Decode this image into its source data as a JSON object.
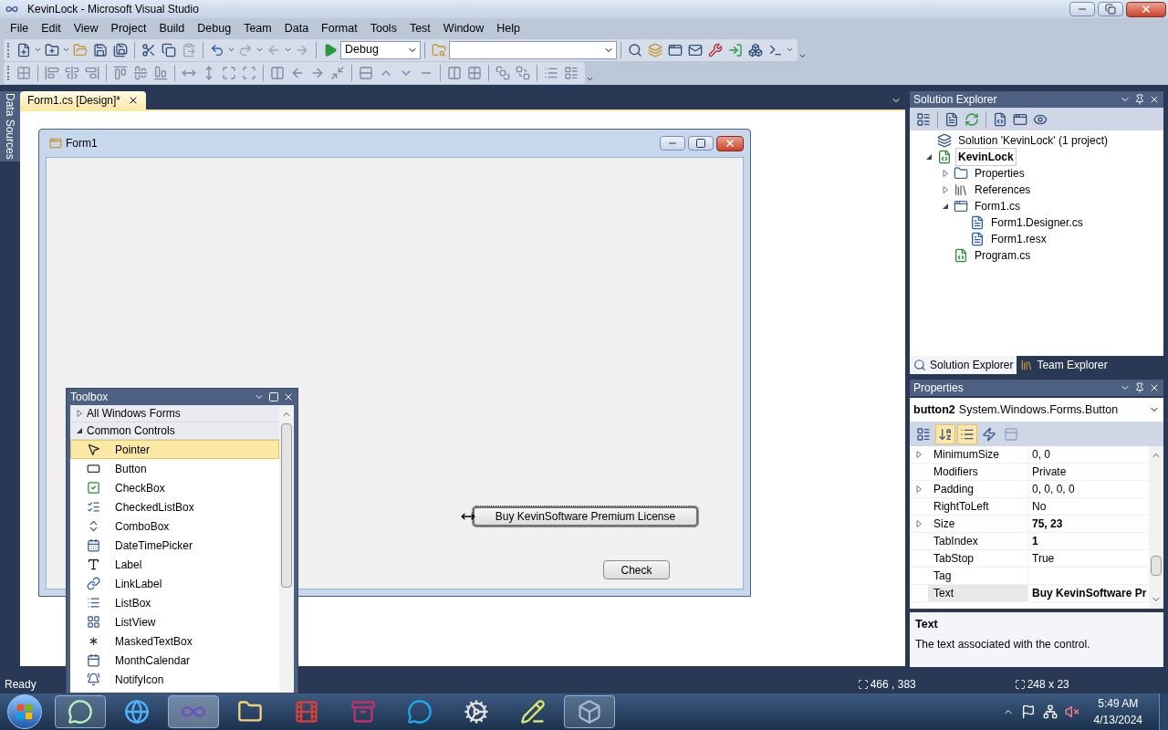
{
  "window": {
    "title": "KevinLock - Microsoft Visual Studio"
  },
  "menu": [
    "File",
    "Edit",
    "View",
    "Project",
    "Build",
    "Debug",
    "Team",
    "Data",
    "Format",
    "Tools",
    "Test",
    "Window",
    "Help"
  ],
  "toolbar": {
    "configuration": "Debug"
  },
  "side_tabs": [
    "Data Sources"
  ],
  "document_tabs": [
    {
      "label": "Form1.cs [Design]*",
      "selected": true
    }
  ],
  "form": {
    "title": "Form1",
    "controls": [
      {
        "text": "Buy KevinSoftware Premium License",
        "selected": true,
        "kind": "wide"
      },
      {
        "text": "Check",
        "selected": false,
        "kind": "small"
      }
    ]
  },
  "toolbox": {
    "title": "Toolbox",
    "groups": [
      {
        "label": "All Windows Forms",
        "expanded": false
      },
      {
        "label": "Common Controls",
        "expanded": true,
        "items": [
          {
            "label": "Pointer",
            "kind": "pointer",
            "selected": true
          },
          {
            "label": "Button",
            "kind": "button",
            "selected": false
          },
          {
            "label": "CheckBox",
            "kind": "checkbox",
            "selected": false
          },
          {
            "label": "CheckedListBox",
            "kind": "checkedlistbox",
            "selected": false
          },
          {
            "label": "ComboBox",
            "kind": "combobox",
            "selected": false
          },
          {
            "label": "DateTimePicker",
            "kind": "datetimepicker",
            "selected": false
          },
          {
            "label": "Label",
            "kind": "label",
            "selected": false
          },
          {
            "label": "LinkLabel",
            "kind": "linklabel",
            "selected": false
          },
          {
            "label": "ListBox",
            "kind": "listbox",
            "selected": false
          },
          {
            "label": "ListView",
            "kind": "listview",
            "selected": false
          },
          {
            "label": "MaskedTextBox",
            "kind": "maskedtextbox",
            "selected": false
          },
          {
            "label": "MonthCalendar",
            "kind": "monthcalendar",
            "selected": false
          },
          {
            "label": "NotifyIcon",
            "kind": "notifyicon",
            "selected": false
          }
        ]
      }
    ]
  },
  "solution_explorer": {
    "title": "Solution Explorer",
    "tree": [
      {
        "label": "Solution 'KevinLock' (1 project)",
        "kind": "solution",
        "selected": false,
        "children": [
          {
            "label": "KevinLock",
            "kind": "project",
            "selected": true,
            "expanded": true,
            "children": [
              {
                "label": "Properties",
                "kind": "properties",
                "selected": false,
                "expanded": false
              },
              {
                "label": "References",
                "kind": "references",
                "selected": false,
                "expanded": false
              },
              {
                "label": "Form1.cs",
                "kind": "form",
                "selected": false,
                "expanded": true,
                "children": [
                  {
                    "label": "Form1.Designer.cs",
                    "kind": "file",
                    "selected": false
                  },
                  {
                    "label": "Form1.resx",
                    "kind": "file",
                    "selected": false
                  }
                ]
              },
              {
                "label": "Program.cs",
                "kind": "csfile",
                "selected": false
              }
            ]
          }
        ]
      }
    ],
    "tabs": [
      {
        "label": "Solution Explorer",
        "selected": true
      },
      {
        "label": "Team Explorer",
        "selected": false
      }
    ]
  },
  "properties": {
    "title": "Properties",
    "object_name": "button2",
    "object_type": "System.Windows.Forms.Button",
    "view_buttons": [
      {
        "kind": "categorized",
        "selected": false,
        "disabled": false
      },
      {
        "kind": "alphabetical",
        "selected": true,
        "disabled": false
      },
      {
        "kind": "properties",
        "selected": true,
        "disabled": false
      },
      {
        "kind": "events",
        "selected": false,
        "disabled": false
      },
      {
        "kind": "pages",
        "selected": false,
        "disabled": true
      }
    ],
    "rows": [
      {
        "name": "MinimumSize",
        "value": "0, 0",
        "expandable": true,
        "modified": false,
        "selected": false
      },
      {
        "name": "Modifiers",
        "value": "Private",
        "expandable": false,
        "modified": false,
        "selected": false
      },
      {
        "name": "Padding",
        "value": "0, 0, 0, 0",
        "expandable": true,
        "modified": false,
        "selected": false
      },
      {
        "name": "RightToLeft",
        "value": "No",
        "expandable": false,
        "modified": false,
        "selected": false
      },
      {
        "name": "Size",
        "value": "75, 23",
        "expandable": true,
        "modified": true,
        "selected": false
      },
      {
        "name": "TabIndex",
        "value": "1",
        "expandable": false,
        "modified": true,
        "selected": false
      },
      {
        "name": "TabStop",
        "value": "True",
        "expandable": false,
        "modified": false,
        "selected": false
      },
      {
        "name": "Tag",
        "expandable": false,
        "selected": false
      },
      {
        "name": "Text",
        "value": "Buy KevinSoftware Pr",
        "expandable": false,
        "modified": true,
        "selected": true
      }
    ],
    "description": {
      "title": "Text",
      "text": "The text associated with the control."
    }
  },
  "status_bar": {
    "text": "Ready",
    "position": "466 , 383",
    "size": "248 x 23"
  },
  "taskbar": {
    "apps": [
      {
        "kind": "chat",
        "running": true,
        "selected": false
      },
      {
        "kind": "browser",
        "running": false,
        "selected": false
      },
      {
        "kind": "studio",
        "running": true,
        "selected": true
      },
      {
        "kind": "folder",
        "running": false,
        "selected": false
      },
      {
        "kind": "film",
        "running": false,
        "selected": false
      },
      {
        "kind": "archive",
        "running": false,
        "selected": false
      },
      {
        "kind": "skype",
        "running": false,
        "selected": false
      },
      {
        "kind": "steam",
        "running": false,
        "selected": false
      },
      {
        "kind": "editor",
        "running": false,
        "selected": false
      },
      {
        "kind": "vm",
        "running": true,
        "selected": false
      }
    ],
    "time": "5:49 AM",
    "date": "4/13/2024"
  }
}
